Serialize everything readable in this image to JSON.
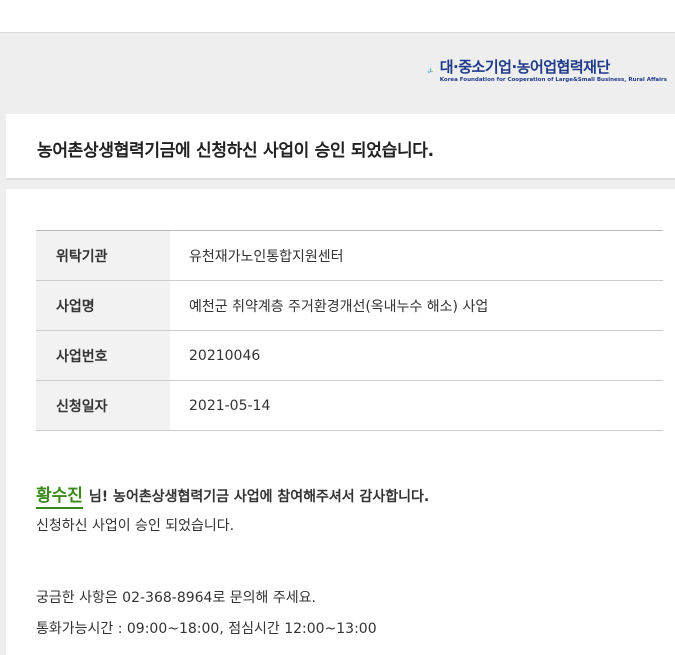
{
  "header": {
    "logo": {
      "name_ko": "대·중소기업·농어업협력재단",
      "name_en": "Korea Foundation for Cooperation of Large&Small Business, Rural Affairs"
    }
  },
  "notice": {
    "title": "농어촌상생협력기금에 신청하신 사업이 승인 되었습니다."
  },
  "info_table": {
    "rows": [
      {
        "label": "위탁기관",
        "value": "유천재가노인통합지원센터"
      },
      {
        "label": "사업명",
        "value": "예천군 취약계층 주거환경개선(옥내누수 해소) 사업"
      },
      {
        "label": "사업번호",
        "value": "20210046"
      },
      {
        "label": "신청일자",
        "value": "2021-05-14"
      }
    ]
  },
  "message": {
    "user_name": "황수진",
    "thanks": "님! 농어촌상생협력기금 사업에 참여해주셔서 감사합니다.",
    "approved": "신청하신 사업이 승인 되었습니다.",
    "contact": "궁금한 사항은 02-368-8964로 문의해 주세요.",
    "hours": "통화가능시간 : 09:00~18:00, 점심시간 12:00~13:00"
  },
  "colors": {
    "accent_green": "#3a8a1a",
    "logo_navy": "#1e3a8a",
    "logo_cyan": "#19b5e6",
    "background_gray": "#eeeeee"
  }
}
